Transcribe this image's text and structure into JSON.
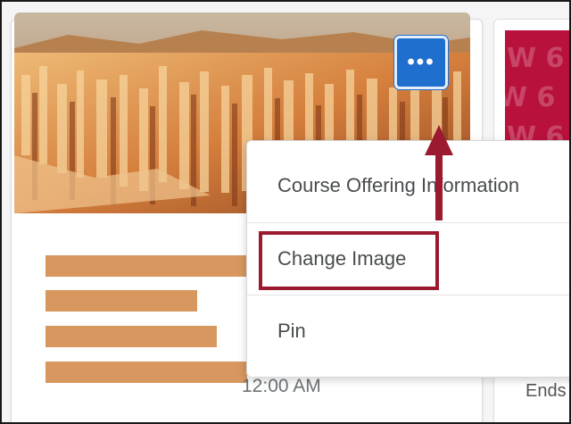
{
  "menu": {
    "items": [
      {
        "label": "Course Offering Information"
      },
      {
        "label": "Change Image"
      },
      {
        "label": "Pin"
      }
    ]
  },
  "card": {
    "time_text": "12:00 AM",
    "more_button_glyph": "•••"
  },
  "adjacent_card": {
    "ends_text": "Ends",
    "pattern_glyph": "W 6"
  },
  "colors": {
    "accent_blue": "#1f6fcf",
    "highlight_red": "#9c1a2f",
    "placeholder_bar": "#d7975f",
    "adjacent_card_bg": "#b8113c"
  }
}
